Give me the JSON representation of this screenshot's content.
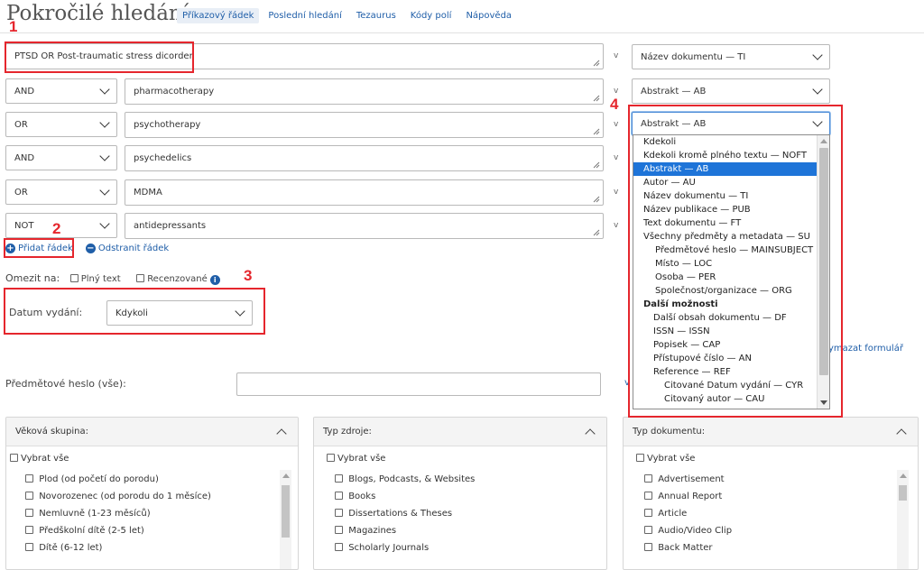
{
  "header": {
    "title": "Pokročilé hledání",
    "nav": [
      "Příkazový řádek",
      "Poslední hledání",
      "Tezaurus",
      "Kódy polí",
      "Nápověda"
    ]
  },
  "search_rows": [
    {
      "operator": "",
      "term": "PTSD OR Post-traumatic stress dicorder",
      "field": "Název dokumentu — TI"
    },
    {
      "operator": "AND",
      "term": "pharmacotherapy",
      "field": "Abstrakt — AB"
    },
    {
      "operator": "OR",
      "term": "psychotherapy",
      "field": "Abstrakt — AB"
    },
    {
      "operator": "AND",
      "term": "psychedelics",
      "field": ""
    },
    {
      "operator": "OR",
      "term": "MDMA",
      "field": ""
    },
    {
      "operator": "NOT",
      "term": "antidepressants",
      "field": ""
    }
  ],
  "row_joiner": "v",
  "links": {
    "add_row": "Přidat řádek",
    "remove_row": "Odstranit řádek"
  },
  "limit": {
    "label": "Omezit na:",
    "fulltext": "Plný text",
    "peer": "Recenzované"
  },
  "date": {
    "label": "Datum vydání:",
    "value": "Kdykoli"
  },
  "subject": {
    "label": "Předmětové heslo (vše):",
    "suffix": "v"
  },
  "clear_form": "ymazat formulář",
  "callouts": [
    "1",
    "2",
    "3",
    "4"
  ],
  "dropdown_options": [
    {
      "label": "Kdekoli",
      "indent": 0
    },
    {
      "label": "Kdekoli kromě plného textu — NOFT",
      "indent": 0
    },
    {
      "label": "Abstrakt — AB",
      "indent": 0,
      "selected": true
    },
    {
      "label": "Autor — AU",
      "indent": 0
    },
    {
      "label": "Název dokumentu — TI",
      "indent": 0
    },
    {
      "label": "Název publikace — PUB",
      "indent": 0
    },
    {
      "label": "Text dokumentu — FT",
      "indent": 0
    },
    {
      "label": "Všechny předměty a metadata — SU",
      "indent": 0
    },
    {
      "label": "Předmětové heslo — MAINSUBJECT",
      "indent": 1
    },
    {
      "label": "Místo — LOC",
      "indent": 1
    },
    {
      "label": "Osoba — PER",
      "indent": 1
    },
    {
      "label": "Společnost/organizace — ORG",
      "indent": 1
    },
    {
      "label": "Další možnosti",
      "indent": 0,
      "bold": true
    },
    {
      "label": "Další obsah dokumentu — DF",
      "indent": 1
    },
    {
      "label": "ISSN — ISSN",
      "indent": 1
    },
    {
      "label": "Popisek — CAP",
      "indent": 1
    },
    {
      "label": "Přístupové číslo — AN",
      "indent": 1
    },
    {
      "label": "Reference — REF",
      "indent": 1
    },
    {
      "label": "Citované Datum vydání — CYR",
      "indent": 2
    },
    {
      "label": "Citovaný autor — CAU",
      "indent": 2
    }
  ],
  "panels": [
    {
      "title": "Věková skupina:",
      "select_all": "Vybrat vše",
      "options": [
        "Plod (od početí do porodu)",
        "Novorozenec (od porodu do 1 měsíce)",
        "Nemluvně (1-23 měsíců)",
        "Předškolní dítě (2-5 let)",
        "Dítě (6-12 let)"
      ]
    },
    {
      "title": "Typ zdroje:",
      "select_all": "Vybrat vše",
      "options": [
        "Blogs, Podcasts, & Websites",
        "Books",
        "Dissertations & Theses",
        "Magazines",
        "Scholarly Journals"
      ]
    },
    {
      "title": "Typ dokumentu:",
      "select_all": "Vybrat vše",
      "options": [
        "Advertisement",
        "Annual Report",
        "Article",
        "Audio/Video Clip",
        "Back Matter"
      ]
    }
  ]
}
